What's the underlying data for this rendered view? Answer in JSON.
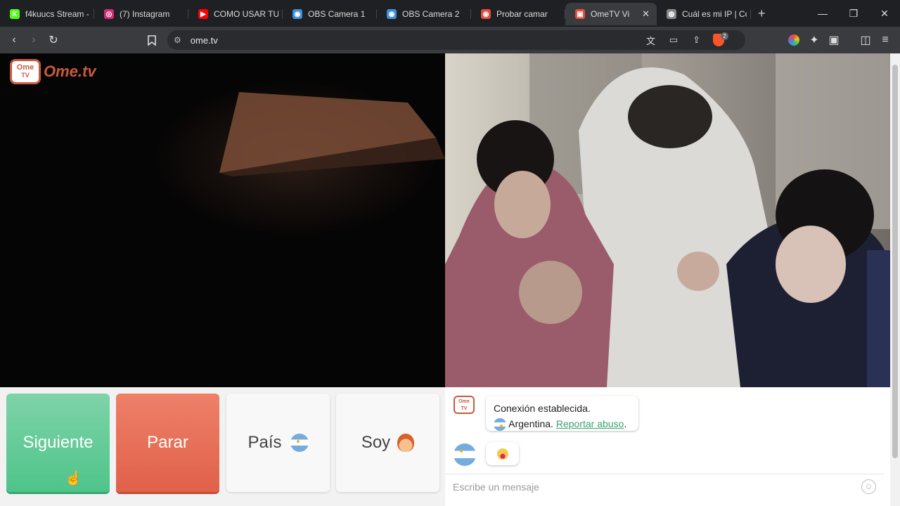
{
  "tabs": [
    {
      "title": "f4kuucs Stream -",
      "fav_color": "#53fc18",
      "fav_glyph": "K"
    },
    {
      "title": "(7) Instagram",
      "fav_color": "#d62976",
      "fav_glyph": "◎"
    },
    {
      "title": "COMO USAR TU C",
      "fav_color": "#ff0000",
      "fav_glyph": "▶"
    },
    {
      "title": "OBS Camera 1",
      "fav_color": "#3d8fd6",
      "fav_glyph": "◉"
    },
    {
      "title": "OBS Camera 2",
      "fav_color": "#3d8fd6",
      "fav_glyph": "◉"
    },
    {
      "title": "Probar camar",
      "fav_color": "#e74c3c",
      "fav_glyph": "◉"
    },
    {
      "title": "OmeTV Vi",
      "fav_color": "#e74c3c",
      "fav_glyph": "▣",
      "active": true
    },
    {
      "title": "Cuál es mi IP | Có",
      "fav_color": "#888888",
      "fav_glyph": "◍"
    }
  ],
  "url": "ome.tv",
  "logo": {
    "ome": "Ome",
    "tv": "TV",
    "text": "Ome.tv"
  },
  "controls": {
    "next": "Siguiente",
    "stop": "Parar",
    "country": "País",
    "gender": "Soy"
  },
  "chat": {
    "status": "Conexión establecida.",
    "country": "Argentina.",
    "report_link": "Reportar abuso",
    "period": ".",
    "placeholder": "Escribe un mensaje"
  },
  "badge_count": "2"
}
